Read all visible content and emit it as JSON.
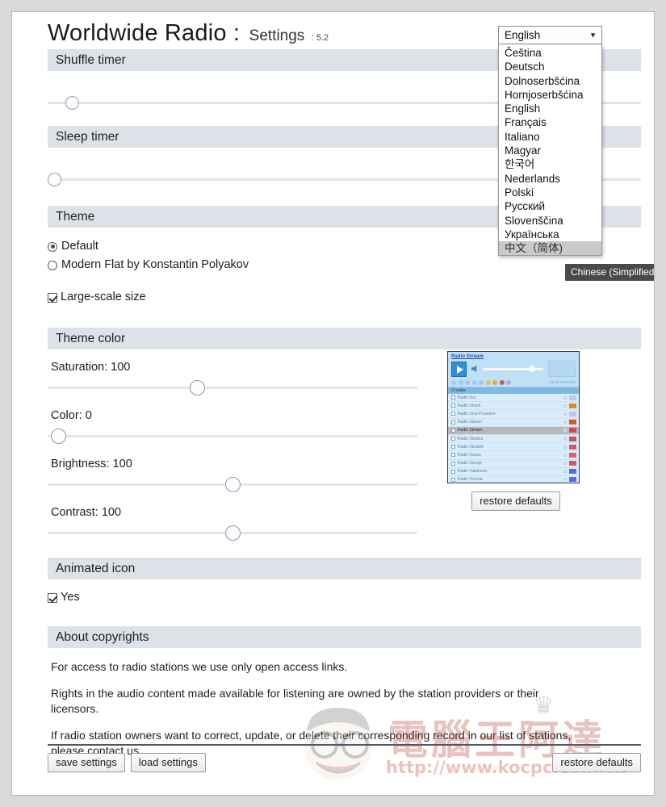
{
  "header": {
    "title": "Worldwide Radio :",
    "subtitle": "Settings",
    "version": ": 5.2"
  },
  "language": {
    "selected": "English",
    "caret_icon": "chevron-down-icon",
    "options": [
      "Čeština",
      "Deutsch",
      "Dolnoserbšćina",
      "Hornjoserbšćina",
      "English",
      "Français",
      "Italiano",
      "Magyar",
      "한국어",
      "Nederlands",
      "Polski",
      "Русский",
      "Slovenščina",
      "Українська",
      "中文（简体)"
    ],
    "highlighted_index": 14,
    "tooltip": "Chinese (Simplified)"
  },
  "sections": {
    "shuffle_timer": {
      "title": "Shuffle timer",
      "slider_percent": 3
    },
    "sleep_timer": {
      "title": "Sleep timer",
      "slider_percent": 0
    },
    "theme": {
      "title": "Theme",
      "radios": [
        {
          "label": "Default",
          "checked": true
        },
        {
          "label": "Modern Flat by Konstantin Polyakov",
          "checked": false
        }
      ],
      "checkbox": {
        "label": "Large-scale size",
        "checked": true
      }
    },
    "theme_color": {
      "title": "Theme color",
      "sliders": [
        {
          "label": "Saturation: 100",
          "name": "saturation",
          "value": 100,
          "percent": 40
        },
        {
          "label": "Color: 0",
          "name": "color",
          "value": 0,
          "percent": 1
        },
        {
          "label": "Brightness: 100",
          "name": "brightness",
          "value": 100,
          "percent": 50
        },
        {
          "label": "Contrast: 100",
          "name": "contrast",
          "value": 100,
          "percent": 50
        }
      ],
      "restore_label": "restore defaults"
    },
    "animated_icon": {
      "title": "Animated icon",
      "checkbox": {
        "label": "Yes",
        "checked": true
      }
    },
    "about_copyrights": {
      "title": "About copyrights",
      "paragraphs": [
        "For access to radio stations we use only open access links.",
        "Rights in the audio content made available for listening are owned by the station providers or their licensors.",
        "If radio station owners want to correct, update, or delete their corresponding record in our list of stations, please contact us."
      ]
    }
  },
  "preview": {
    "station_title": "Radio Stream",
    "counter": "100 of 1000 files",
    "group": "Croatia",
    "stations": [
      {
        "name": "Radio Dur",
        "active": false
      },
      {
        "name": "Radio Shock",
        "active": false
      },
      {
        "name": "Radio Srce Posavine",
        "active": false
      },
      {
        "name": "Radio Slavon",
        "active": false
      },
      {
        "name": "Radio Stream",
        "active": true
      },
      {
        "name": "Radio Stubica",
        "active": false
      },
      {
        "name": "Radio Student",
        "active": false
      },
      {
        "name": "Radio Sunca",
        "active": false
      },
      {
        "name": "Radio Sviraje",
        "active": false
      },
      {
        "name": "Radio Tabakovic",
        "active": false
      },
      {
        "name": "Radio Terezia",
        "active": false
      }
    ]
  },
  "footer": {
    "save_label": "save settings",
    "load_label": "load settings",
    "restore_label": "restore defaults"
  },
  "watermark": {
    "cjk": "電腦王阿達",
    "url": "http://www.kocpc.com.tw"
  }
}
